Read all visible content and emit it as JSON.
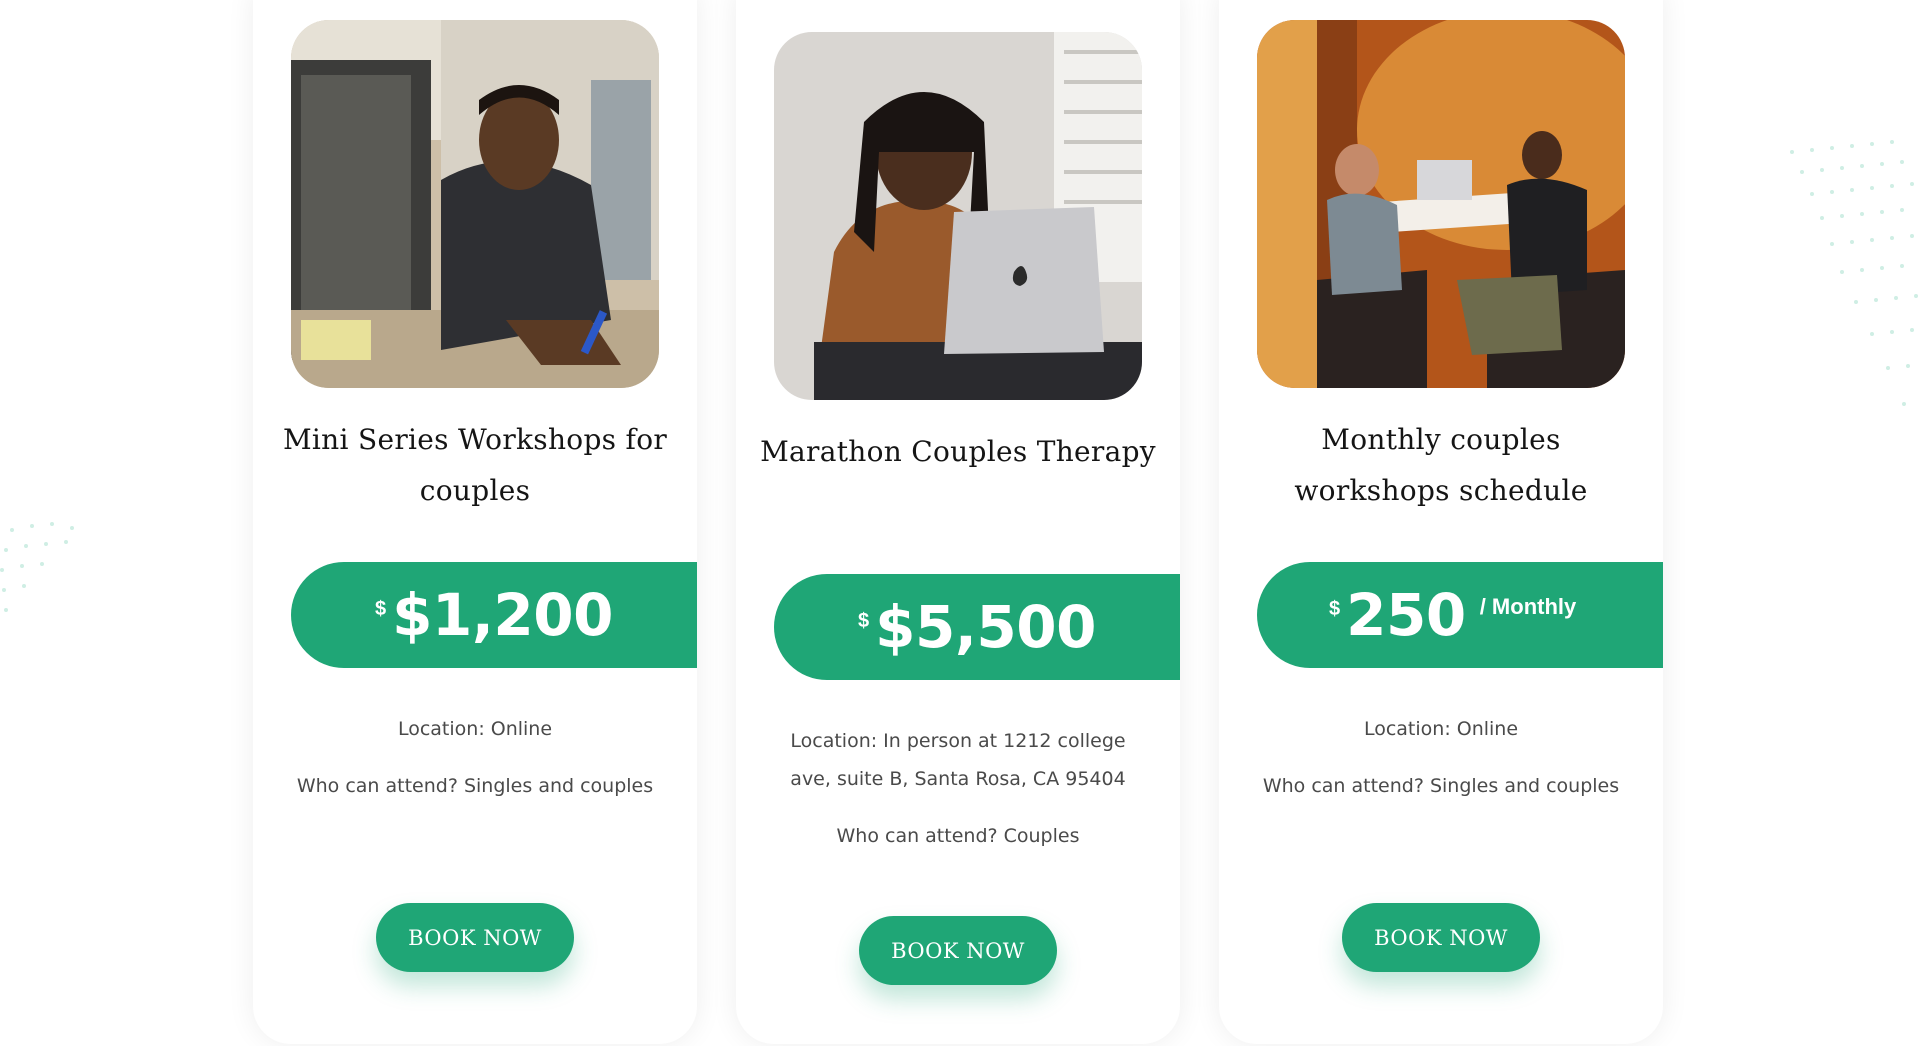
{
  "cards": [
    {
      "title": "Mini Series Workshops for couples",
      "currency": "$",
      "price": "$1,200",
      "period": "",
      "location": "Location: Online",
      "attend": "Who can attend? Singles and couples",
      "button": "BOOK NOW"
    },
    {
      "title": "Marathon Couples Therapy",
      "currency": "$",
      "price": "$5,500",
      "period": "",
      "location": "Location: In person at 1212 college ave, suite B, Santa Rosa, CA 95404",
      "attend": "Who can attend? Couples",
      "button": "BOOK NOW"
    },
    {
      "title": "Monthly couples workshops schedule",
      "currency": "$",
      "price": "250",
      "period": "/ Monthly",
      "location": "Location: Online",
      "attend": "Who can attend? Singles and couples",
      "button": "BOOK NOW"
    }
  ],
  "colors": {
    "accent": "#1fa676",
    "text": "#151515",
    "muted": "#4a4a4a",
    "dots": "#cfeee4"
  },
  "images": [
    {
      "icon": "photo-man-writing-at-desk"
    },
    {
      "icon": "photo-woman-with-laptop"
    },
    {
      "icon": "photo-two-men-meeting-in-booth"
    }
  ]
}
